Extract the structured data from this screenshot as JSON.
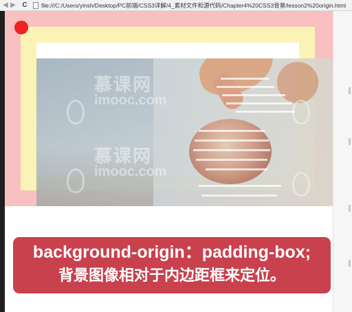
{
  "browser": {
    "back_icon": "arrow-left-icon",
    "back_glyph": "◀",
    "forward_icon": "arrow-right-icon",
    "forward_glyph": "▶",
    "reload_icon": "reload-icon",
    "reload_glyph": "C",
    "page_icon": "page-icon",
    "url": "file:///C:/Users/yinsh/Desktop/PC前端/CSS3详解/4_素材文件和源代码/Chapter4%20CSS3背景/lesson2%20origin.html"
  },
  "demo": {
    "colors": {
      "border_area": "#f8c0c0",
      "padding_area": "#fbf3b5",
      "content_area": "#ffffff",
      "origin_marker": "#ee2424"
    },
    "watermark": {
      "cn": "慕课网",
      "en": "imooc.com"
    }
  },
  "caption": {
    "background": "#c8414d",
    "line1": "background-origin：padding-box;",
    "line2": "背景图像相对于内边距框来定位。"
  }
}
